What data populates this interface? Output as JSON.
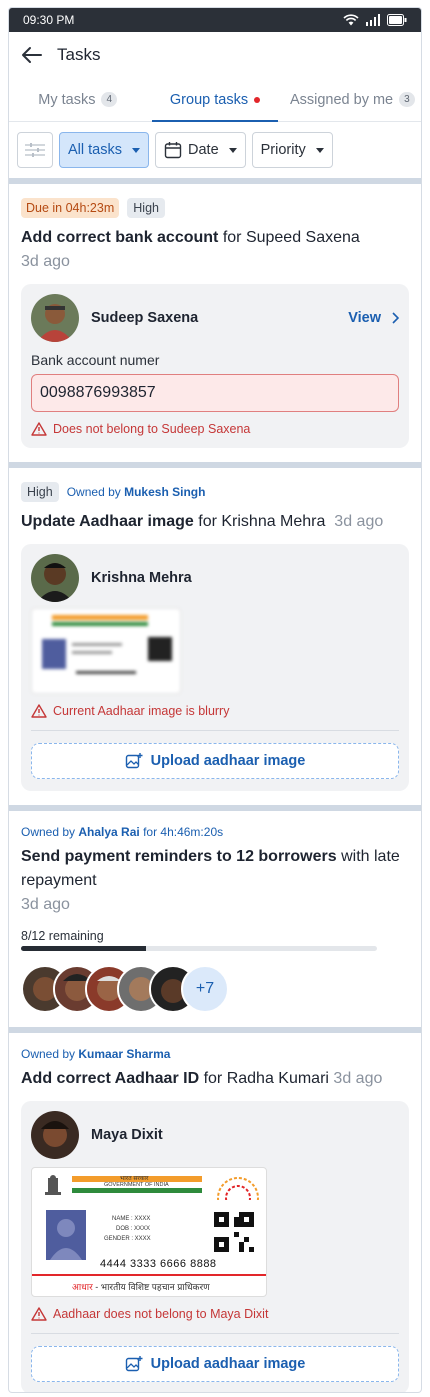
{
  "status_bar": {
    "time": "09:30 PM"
  },
  "header": {
    "title": "Tasks"
  },
  "tabs": [
    {
      "label": "My tasks",
      "count": "4"
    },
    {
      "label": "Group tasks"
    },
    {
      "label": "Assigned by me",
      "count": "3"
    }
  ],
  "filters": {
    "all_tasks": "All tasks",
    "date": "Date",
    "priority": "Priority"
  },
  "tasks": [
    {
      "due": "Due in 04h:23m",
      "priority": "High",
      "title_bold": "Add correct bank account",
      "title_rest": " for Supeed Saxena",
      "ago": "3d ago",
      "person": "Sudeep Saxena",
      "view": "View",
      "field_label": "Bank account numer",
      "field_value": "0098876993857",
      "error": "Does not belong to Sudeep Saxena"
    },
    {
      "priority": "High",
      "owned_prefix": "Owned by",
      "owner": "Mukesh Singh",
      "title_bold": "Update Aadhaar image",
      "title_rest": " for Krishna Mehra",
      "ago": "3d ago",
      "person": "Krishna Mehra",
      "error": "Current Aadhaar image is blurry",
      "upload": "Upload aadhaar image"
    },
    {
      "owned_prefix": "Owned by",
      "owner": "Ahalya Rai",
      "owned_suffix": " for 4h:46m:20s",
      "title_bold": "Send payment reminders to 12 borrowers",
      "title_rest": " with late repayment",
      "ago": "3d ago",
      "progress_label": "8/12 remaining",
      "progress_fraction": 0.35,
      "more": "+7"
    },
    {
      "owned_prefix": "Owned by",
      "owner": "Kumaar Sharma",
      "title_bold": "Add correct Aadhaar ID",
      "title_rest": " for Radha Kumari",
      "ago": "3d ago",
      "person": "Maya Dixit",
      "error": "Aadhaar does not belong to Maya Dixit",
      "upload": "Upload aadhaar image",
      "card": {
        "gov": "भारत सरकार",
        "gov_en": "GOVERNMENT OF INDIA",
        "name": "NAME : XXXX",
        "dob": "DOB : XXXX",
        "gender": "GENDER : XXXX",
        "number": "4444 3333 6666 8888",
        "footer_red": "आधार",
        "footer": " - भारतीय विशिष्ट पहचान प्राधिकरण"
      }
    }
  ]
}
